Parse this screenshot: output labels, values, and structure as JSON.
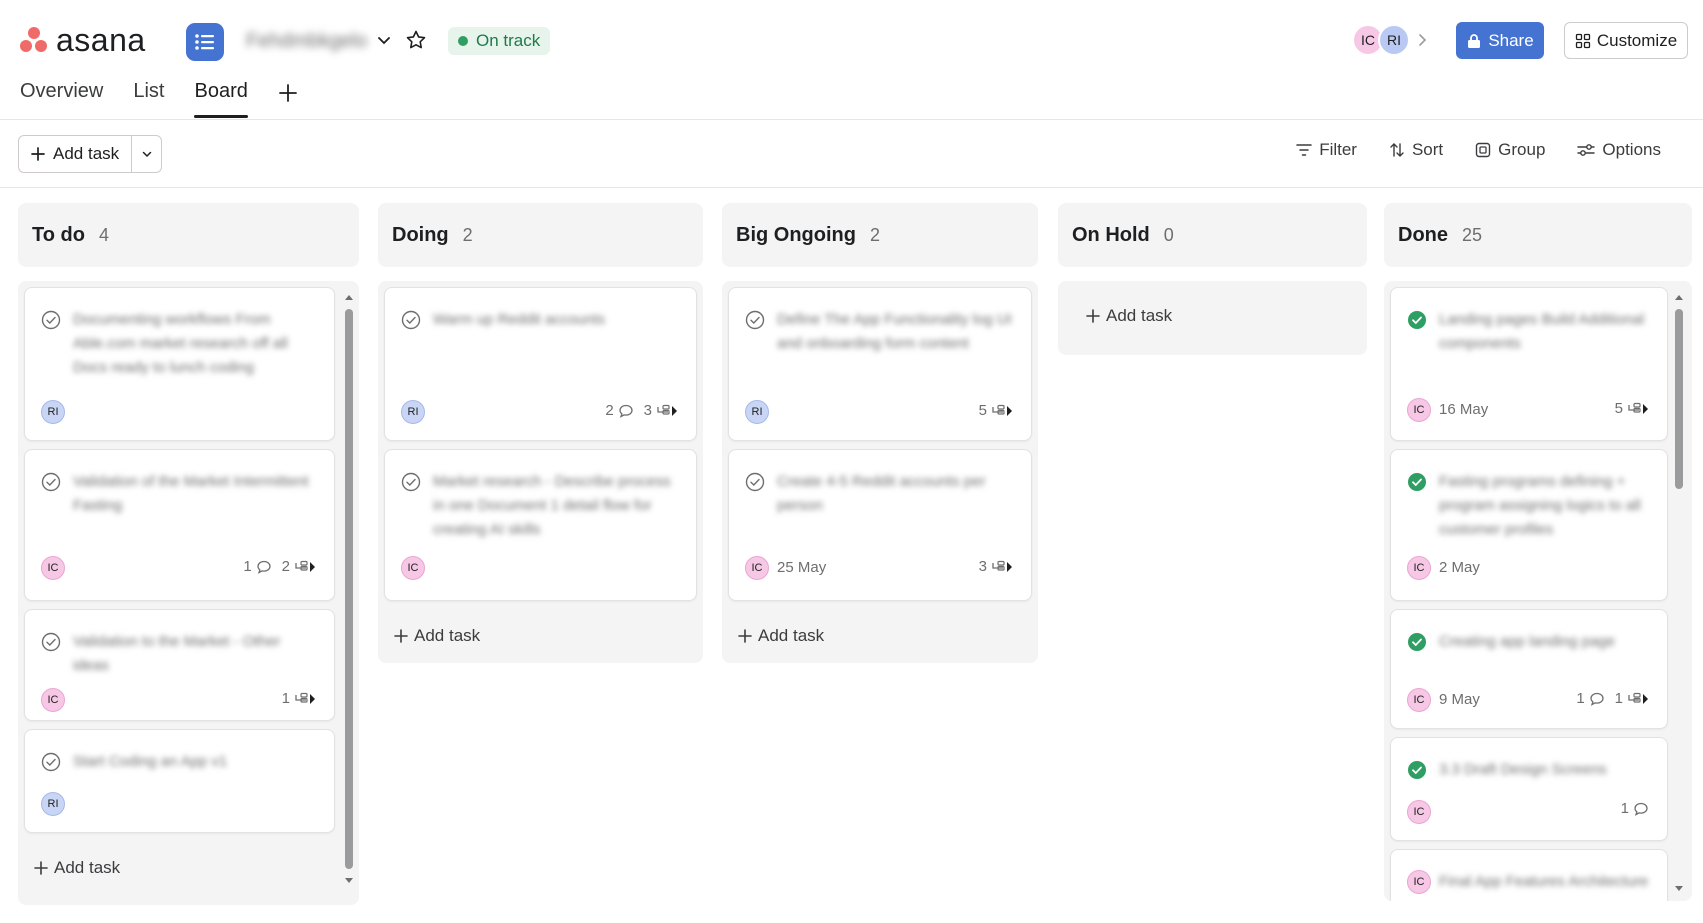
{
  "header": {
    "logo_text": "asana",
    "project_name": "Fehdmbkgelo",
    "status": "On track",
    "colors": {
      "brand": "#f06a6a",
      "primary": "#4573d2",
      "status_green": "#2f9e63"
    },
    "members": [
      {
        "initials": "IC",
        "color": "#f7c7e6"
      },
      {
        "initials": "RI",
        "color": "#b9c9f3"
      }
    ],
    "share_label": "Share",
    "customize_label": "Customize"
  },
  "tabs": [
    {
      "label": "Overview",
      "active": false
    },
    {
      "label": "List",
      "active": false
    },
    {
      "label": "Board",
      "active": true
    }
  ],
  "toolbar": {
    "add_task_label": "Add task",
    "filter_label": "Filter",
    "sort_label": "Sort",
    "group_label": "Group",
    "options_label": "Options"
  },
  "columns": [
    {
      "title": "To do",
      "count": "4",
      "add_label": "Add task",
      "cards": [
        {
          "title": "Documenting workflows From Able.com market research off all Docs ready to lunch coding",
          "assignee": "RI",
          "date": "",
          "comments": "",
          "subtasks": ""
        },
        {
          "title": "Validation of the Market Intermittent Fasting",
          "assignee": "IC",
          "date": "",
          "comments": "1",
          "subtasks": "2"
        },
        {
          "title": "Validation to the Market - Other ideas",
          "assignee": "IC",
          "date": "",
          "comments": "",
          "subtasks": "1"
        },
        {
          "title": "Start Coding an App v1",
          "assignee": "RI",
          "date": "",
          "comments": "",
          "subtasks": ""
        }
      ]
    },
    {
      "title": "Doing",
      "count": "2",
      "add_label": "Add task",
      "cards": [
        {
          "title": "Warm up Reddit accounts",
          "assignee": "RI",
          "date": "",
          "comments": "2",
          "subtasks": "3"
        },
        {
          "title": "Market research - Describe process in one Document 1 detail flow for creating AI skills",
          "assignee": "IC",
          "date": "",
          "comments": "",
          "subtasks": ""
        }
      ]
    },
    {
      "title": "Big Ongoing",
      "count": "2",
      "add_label": "Add task",
      "cards": [
        {
          "title": "Define The App Functionality log UI and onboarding form content",
          "assignee": "RI",
          "date": "",
          "comments": "",
          "subtasks": "5"
        },
        {
          "title": "Create 4-5 Reddit accounts per person",
          "assignee": "IC",
          "date": "25 May",
          "comments": "",
          "subtasks": "3"
        }
      ]
    },
    {
      "title": "On Hold",
      "count": "0",
      "add_label": "Add task",
      "cards": []
    },
    {
      "title": "Done",
      "count": "25",
      "add_label": "",
      "cards": [
        {
          "title": "Landing pages Build Additional components",
          "assignee": "IC",
          "date": "16 May",
          "comments": "",
          "subtasks": "5"
        },
        {
          "title": "Fasting programs defining + program assigning logics to all customer profiles",
          "assignee": "IC",
          "date": "2 May",
          "comments": "",
          "subtasks": ""
        },
        {
          "title": "Creating app landing page",
          "assignee": "IC",
          "date": "9 May",
          "comments": "1",
          "subtasks": "1"
        },
        {
          "title": "3.3 Draft Design Screens",
          "assignee": "IC",
          "date": "",
          "comments": "1",
          "subtasks": ""
        },
        {
          "title": "Final App Features Architecture",
          "assignee": "IC",
          "date": "",
          "comments": "",
          "subtasks": ""
        }
      ]
    }
  ]
}
